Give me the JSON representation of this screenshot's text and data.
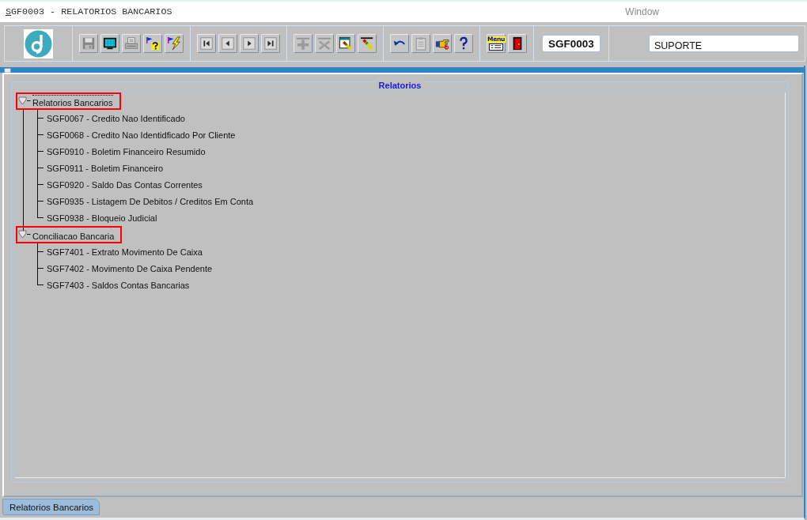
{
  "window": {
    "title": "SGF0003 - RELATORIOS BANCARIOS",
    "menu_label": "Window"
  },
  "toolbar": {
    "groups": [
      {
        "buttons": [
          {
            "kind": "save",
            "disabled": true
          },
          {
            "kind": "screen",
            "disabled": false
          },
          {
            "kind": "print",
            "disabled": true
          },
          {
            "kind": "query",
            "disabled": false
          },
          {
            "kind": "execute",
            "disabled": false
          }
        ]
      },
      {
        "buttons": [
          {
            "kind": "first",
            "disabled": false
          },
          {
            "kind": "previous",
            "disabled": false
          },
          {
            "kind": "next",
            "disabled": false
          },
          {
            "kind": "last",
            "disabled": false
          }
        ]
      },
      {
        "buttons": [
          {
            "kind": "insert",
            "disabled": true
          },
          {
            "kind": "delete",
            "disabled": true
          },
          {
            "kind": "edit",
            "disabled": false
          },
          {
            "kind": "clear",
            "disabled": false
          }
        ]
      },
      {
        "buttons": [
          {
            "kind": "undo",
            "disabled": false
          },
          {
            "kind": "paste",
            "disabled": true
          },
          {
            "kind": "hand",
            "disabled": false
          },
          {
            "kind": "help",
            "disabled": false
          }
        ]
      },
      {
        "buttons": [
          {
            "kind": "menu",
            "label": "Menu",
            "disabled": false
          },
          {
            "kind": "exit",
            "disabled": false
          }
        ]
      }
    ],
    "code_field": {
      "value": "SGF0003"
    },
    "user_field": {
      "value": "SUPORTE"
    }
  },
  "panel": {
    "title": "Relatorios",
    "tree": [
      {
        "label": "Relatorios Bancarios",
        "expanded": true,
        "selected": true,
        "highlighted": true,
        "children": [
          {
            "label": "SGF0067 - Credito Nao Identificado",
            "selected": false
          },
          {
            "label": "SGF0068 - Credito Nao Identidficado Por Cliente",
            "selected": false
          },
          {
            "label": "SGF0910 - Boletim Financeiro Resumido",
            "selected": false
          },
          {
            "label": "SGF0911 - Boletim Financeiro",
            "selected": false
          },
          {
            "label": "SGF0920 - Saldo Das Contas Correntes",
            "selected": false
          },
          {
            "label": "SGF0935 - Listagem De Debitos / Creditos Em Conta",
            "selected": false
          },
          {
            "label": "SGF0938 - Bloqueio Judicial",
            "selected": false
          }
        ]
      },
      {
        "label": "Conciliacao Bancaria",
        "expanded": true,
        "selected": false,
        "highlighted": true,
        "children": [
          {
            "label": "SGF7401 - Extrato Movimento De Caixa",
            "selected": false
          },
          {
            "label": "SGF7402 - Movimento De Caixa Pendente",
            "selected": false
          },
          {
            "label": "SGF7403 - Saldos Contas Bancarias",
            "selected": false
          }
        ]
      }
    ]
  },
  "tabs": [
    {
      "label": "Relatorios Bancarios",
      "selected": true
    }
  ]
}
